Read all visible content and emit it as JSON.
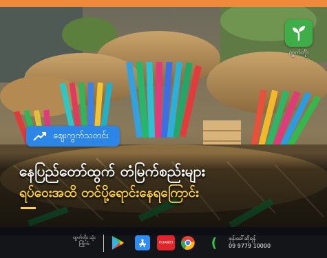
{
  "brand": {
    "logo_name": "ထွက်တိုး",
    "footer_name": "ထွက်တိုး သုံးကြိုက်"
  },
  "badge": {
    "label": "ဈေးကွက်သတင်း",
    "icon": "trend-up-icon"
  },
  "headline": {
    "line1": "နေပြည်တော်ထွက် တံမြက်စည်းများ",
    "line2": "ရပ်ဝေးအထိ တင်ပို့ရောင်းနေရကြောင်း"
  },
  "footer": {
    "stores": [
      "google-play-icon",
      "app-store-icon",
      "huawei-appgallery-icon",
      "chrome-icon",
      "phone-icon"
    ],
    "huawei_label": "HUAWEI",
    "contact_label": "ဖုန်းခေါ်ဆိုရန်",
    "phone": "09 9779 10000"
  },
  "colors": {
    "accent": "#f0893a",
    "badge": "#2c86e8",
    "highlight": "#ffd23f",
    "logo": "#3fae49"
  }
}
